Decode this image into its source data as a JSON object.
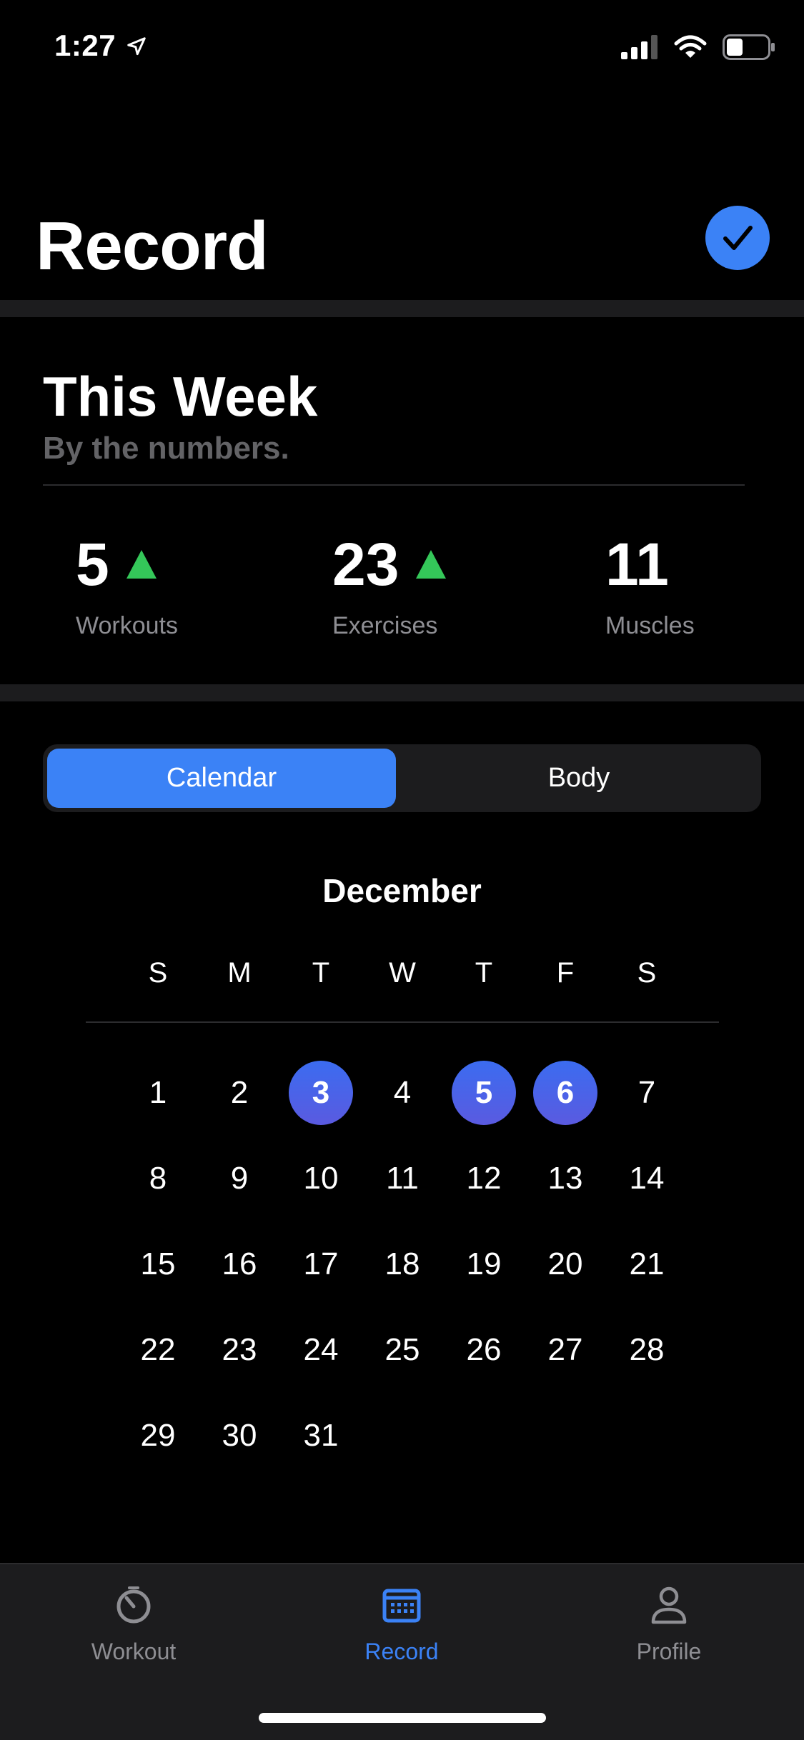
{
  "status_bar": {
    "time": "1:27",
    "icons": [
      "location-arrow-icon",
      "cellular-signal-icon",
      "wifi-icon",
      "battery-icon"
    ]
  },
  "header": {
    "title": "Record",
    "action_icon": "checkmark-icon",
    "accent_color": "#3b82f6"
  },
  "summary": {
    "title": "This Week",
    "subtitle": "By the numbers.",
    "stats": [
      {
        "value": "5",
        "label": "Workouts",
        "trend": "up"
      },
      {
        "value": "23",
        "label": "Exercises",
        "trend": "up"
      },
      {
        "value": "11",
        "label": "Muscles",
        "trend": "none"
      }
    ],
    "trend_color": "#34c759"
  },
  "segments": {
    "options": [
      "Calendar",
      "Body"
    ],
    "selected": "Calendar"
  },
  "calendar": {
    "month": "December",
    "weekdays": [
      "S",
      "M",
      "T",
      "W",
      "T",
      "F",
      "S"
    ],
    "days": [
      "1",
      "2",
      "3",
      "4",
      "5",
      "6",
      "7",
      "8",
      "9",
      "10",
      "11",
      "12",
      "13",
      "14",
      "15",
      "16",
      "17",
      "18",
      "19",
      "20",
      "21",
      "22",
      "23",
      "24",
      "25",
      "26",
      "27",
      "28",
      "29",
      "30",
      "31"
    ],
    "first_weekday_index": 0,
    "highlighted_days": [
      "3",
      "5",
      "6"
    ]
  },
  "tab_bar": {
    "tabs": [
      {
        "label": "Workout",
        "icon": "stopwatch-icon",
        "active": false
      },
      {
        "label": "Record",
        "icon": "calendar-icon",
        "active": true
      },
      {
        "label": "Profile",
        "icon": "person-icon",
        "active": false
      }
    ],
    "active_color": "#3b82f6",
    "inactive_color": "#8e8e93"
  }
}
